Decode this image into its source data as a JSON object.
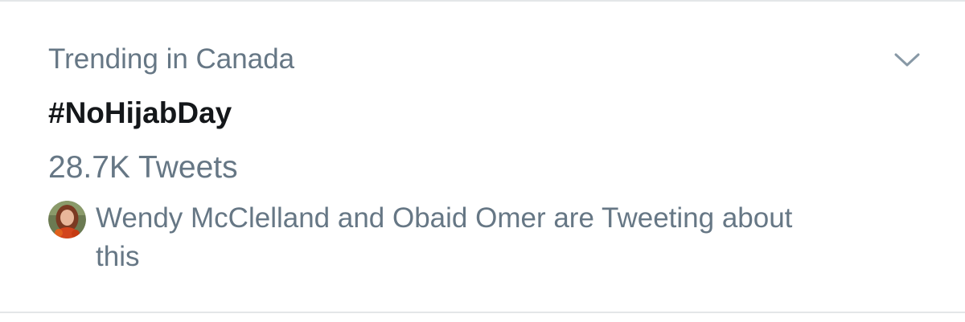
{
  "trend": {
    "context": "Trending in Canada",
    "hashtag": "#NoHijabDay",
    "tweet_count": "28.7K Tweets",
    "social_context": "Wendy McClelland and Obaid Omer are Tweeting about this"
  },
  "icons": {
    "menu": "chevron-down-icon",
    "avatar": "user-avatar"
  },
  "colors": {
    "secondary_text": "#667785",
    "primary_text": "#14171a",
    "divider": "#e3e6e8"
  }
}
